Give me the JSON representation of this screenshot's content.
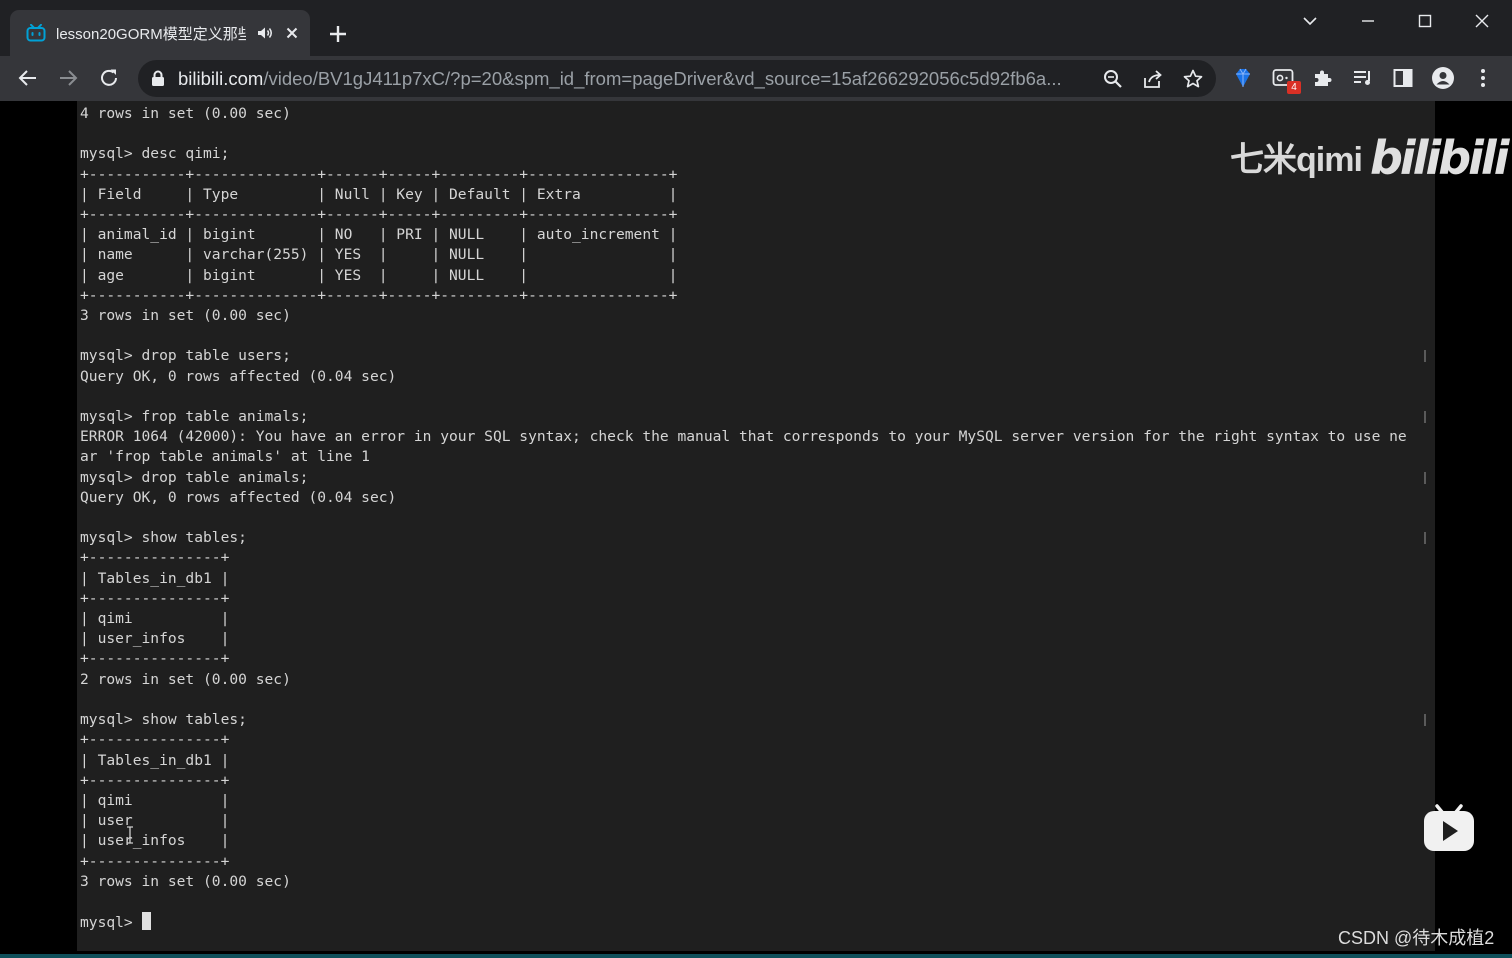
{
  "browser": {
    "tab": {
      "title": "lesson20GORM模型定义那些",
      "favicon": "bilibili-tv-icon",
      "audio_icon": "speaker-icon",
      "close_icon": "close-icon"
    },
    "new_tab_icon": "plus-icon",
    "window_controls": [
      "chevron-down-icon",
      "minimize-icon",
      "maximize-icon",
      "close-icon"
    ],
    "address_bar": {
      "domain": "bilibili.com",
      "path": "/video/BV1gJ411p7xC/?p=20&spm_id_from=pageDriver&vd_source=15af266292056c5d92fb6a..."
    },
    "extension_badge": "4"
  },
  "terminal": {
    "lines": [
      "4 rows in set (0.00 sec)",
      "",
      "mysql> desc qimi;",
      "+-----------+--------------+------+-----+---------+----------------+",
      "| Field     | Type         | Null | Key | Default | Extra          |",
      "+-----------+--------------+------+-----+---------+----------------+",
      "| animal_id | bigint       | NO   | PRI | NULL    | auto_increment |",
      "| name      | varchar(255) | YES  |     | NULL    |                |",
      "| age       | bigint       | YES  |     | NULL    |                |",
      "+-----------+--------------+------+-----+---------+----------------+",
      "3 rows in set (0.00 sec)",
      "",
      "mysql> drop table users;",
      "Query OK, 0 rows affected (0.04 sec)",
      "",
      "mysql> frop table animals;",
      "ERROR 1064 (42000): You have an error in your SQL syntax; check the manual that corresponds to your MySQL server version for the right syntax to use ne",
      "ar 'frop table animals' at line 1",
      "mysql> drop table animals;",
      "Query OK, 0 rows affected (0.04 sec)",
      "",
      "mysql> show tables;",
      "+---------------+",
      "| Tables_in_db1 |",
      "+---------------+",
      "| qimi          |",
      "| user_infos    |",
      "+---------------+",
      "2 rows in set (0.00 sec)",
      "",
      "mysql> show tables;",
      "+---------------+",
      "| Tables_in_db1 |",
      "+---------------+",
      "| qimi          |",
      "| user          |",
      "| user_infos    |",
      "+---------------+",
      "3 rows in set (0.00 sec)",
      ""
    ],
    "prompt": "mysql> "
  },
  "overlay": {
    "watermark_text": "七米qimi",
    "watermark_logo": "bilibili",
    "csdn_credit": "CSDN @待木成植2",
    "play_icon": "play-icon"
  }
}
